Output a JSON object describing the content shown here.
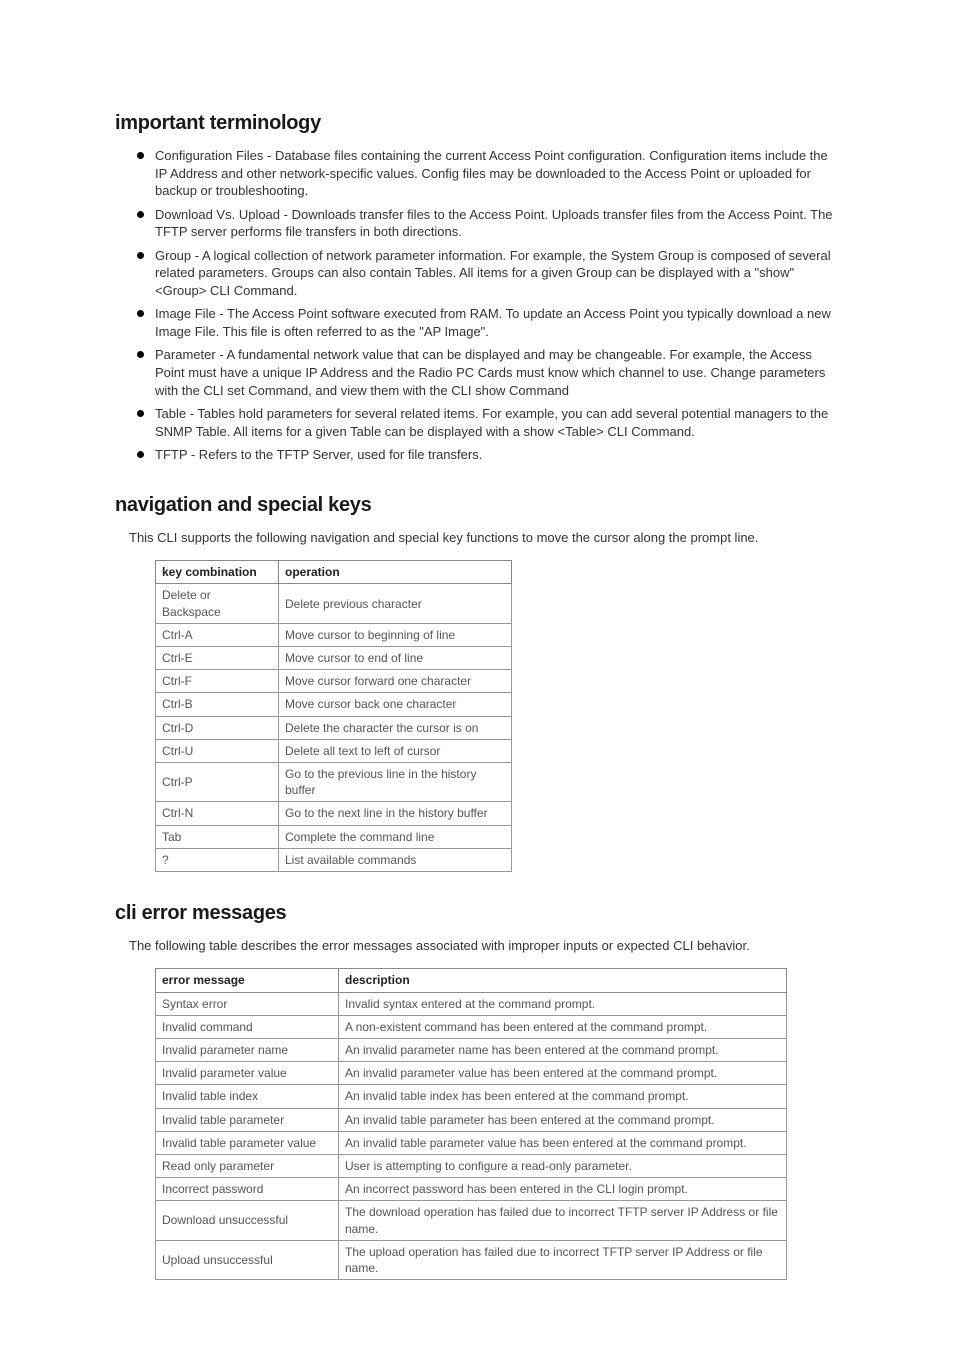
{
  "sections": {
    "terminology": {
      "heading": "important terminology",
      "items": [
        "Configuration Files - Database files containing the current Access Point configuration. Configuration items include the IP Address and other network-specific values. Config files may be downloaded to the Access Point or uploaded for backup or troubleshooting.",
        "Download Vs. Upload - Downloads transfer files to the Access Point. Uploads transfer files from the Access Point. The TFTP server performs file transfers in both directions.",
        "Group - A logical collection of network parameter information. For example, the System Group is composed of several related parameters. Groups can also contain Tables. All items for a given Group can be displayed with a \"show\" <Group> CLI Command.",
        "Image File - The Access Point software executed from RAM. To update an Access Point you typically download a new Image File. This file is often referred to as the \"AP Image\".",
        "Parameter - A fundamental network value that can be displayed and may be changeable. For example, the Access Point must have a unique IP Address and the Radio PC Cards must know which channel to use. Change parameters with the CLI set Command, and view them with the CLI show Command",
        "Table - Tables hold parameters for several related items. For example, you can add several potential managers to the SNMP Table. All items for a given Table can be displayed with a show <Table> CLI Command.",
        "TFTP - Refers to the TFTP Server, used for file transfers."
      ]
    },
    "navigation": {
      "heading": "navigation and special keys",
      "intro": "This CLI supports the following navigation and special key functions to move the cursor along the prompt line.",
      "table": {
        "headers": [
          "key combination",
          "operation"
        ],
        "rows": [
          [
            "Delete or Backspace",
            "Delete previous character"
          ],
          [
            "Ctrl-A",
            "Move cursor to beginning of line"
          ],
          [
            "Ctrl-E",
            "Move cursor to end of line"
          ],
          [
            "Ctrl-F",
            "Move cursor forward one character"
          ],
          [
            "Ctrl-B",
            "Move cursor back one character"
          ],
          [
            "Ctrl-D",
            "Delete the character the cursor is on"
          ],
          [
            "Ctrl-U",
            "Delete all text to left of cursor"
          ],
          [
            "Ctrl-P",
            "Go to the previous line in the history buffer"
          ],
          [
            "Ctrl-N",
            "Go to the next line in the history buffer"
          ],
          [
            "Tab",
            "Complete the command line"
          ],
          [
            "?",
            "List available commands"
          ]
        ]
      }
    },
    "errors": {
      "heading": "cli error messages",
      "intro": "The following table describes the error messages associated with improper inputs or expected CLI behavior.",
      "table": {
        "headers": [
          "error message",
          "description"
        ],
        "rows": [
          [
            "Syntax error",
            "Invalid syntax entered at the command prompt."
          ],
          [
            "Invalid command",
            "A non-existent command has been entered at the command prompt."
          ],
          [
            "Invalid parameter name",
            "An invalid parameter name has been entered at the command prompt."
          ],
          [
            "Invalid parameter value",
            "An invalid parameter value has been entered at the command prompt."
          ],
          [
            "Invalid table index",
            "An invalid table index has been entered at the command prompt."
          ],
          [
            "Invalid table parameter",
            "An invalid table parameter has been entered at the command prompt."
          ],
          [
            "Invalid table parameter value",
            "An invalid table parameter value has been entered at the command prompt."
          ],
          [
            "Read only parameter",
            "User is attempting to configure a read-only parameter."
          ],
          [
            "Incorrect password",
            "An incorrect password has been entered in the CLI login prompt."
          ],
          [
            "Download unsuccessful",
            "The download operation has failed due to incorrect TFTP server IP Address or file name."
          ],
          [
            "Upload unsuccessful",
            "The upload operation has failed due to incorrect TFTP server IP Address or file name."
          ]
        ]
      }
    }
  }
}
